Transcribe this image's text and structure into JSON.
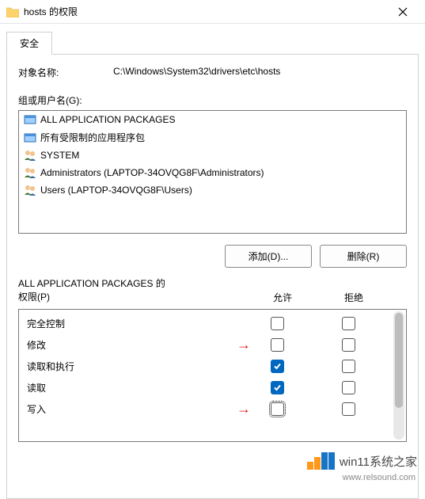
{
  "window": {
    "title": "hosts 的权限"
  },
  "tab": {
    "label": "安全"
  },
  "object": {
    "label": "对象名称:",
    "value": "C:\\Windows\\System32\\drivers\\etc\\hosts"
  },
  "groups": {
    "label": "组或用户名(G):",
    "items": [
      {
        "icon": "package",
        "name": "ALL APPLICATION PACKAGES"
      },
      {
        "icon": "package",
        "name": "所有受限制的应用程序包"
      },
      {
        "icon": "users",
        "name": "SYSTEM"
      },
      {
        "icon": "users",
        "name": "Administrators (LAPTOP-34OVQG8F\\Administrators)"
      },
      {
        "icon": "users",
        "name": "Users (LAPTOP-34OVQG8F\\Users)"
      }
    ]
  },
  "buttons": {
    "add": "添加(D)...",
    "remove": "删除(R)"
  },
  "permissions": {
    "title_line1": "ALL APPLICATION PACKAGES 的",
    "title_line2": "权限(P)",
    "col_allow": "允许",
    "col_deny": "拒绝",
    "rows": [
      {
        "name": "完全控制",
        "allow": false,
        "deny": false,
        "arrow": false,
        "focus": false
      },
      {
        "name": "修改",
        "allow": false,
        "deny": false,
        "arrow": true,
        "focus": false
      },
      {
        "name": "读取和执行",
        "allow": true,
        "deny": false,
        "arrow": false,
        "focus": false
      },
      {
        "name": "读取",
        "allow": true,
        "deny": false,
        "arrow": false,
        "focus": false
      },
      {
        "name": "写入",
        "allow": false,
        "deny": false,
        "arrow": true,
        "focus": true
      }
    ]
  },
  "watermark": {
    "text": "win11系统之家",
    "url": "www.relsound.com"
  }
}
